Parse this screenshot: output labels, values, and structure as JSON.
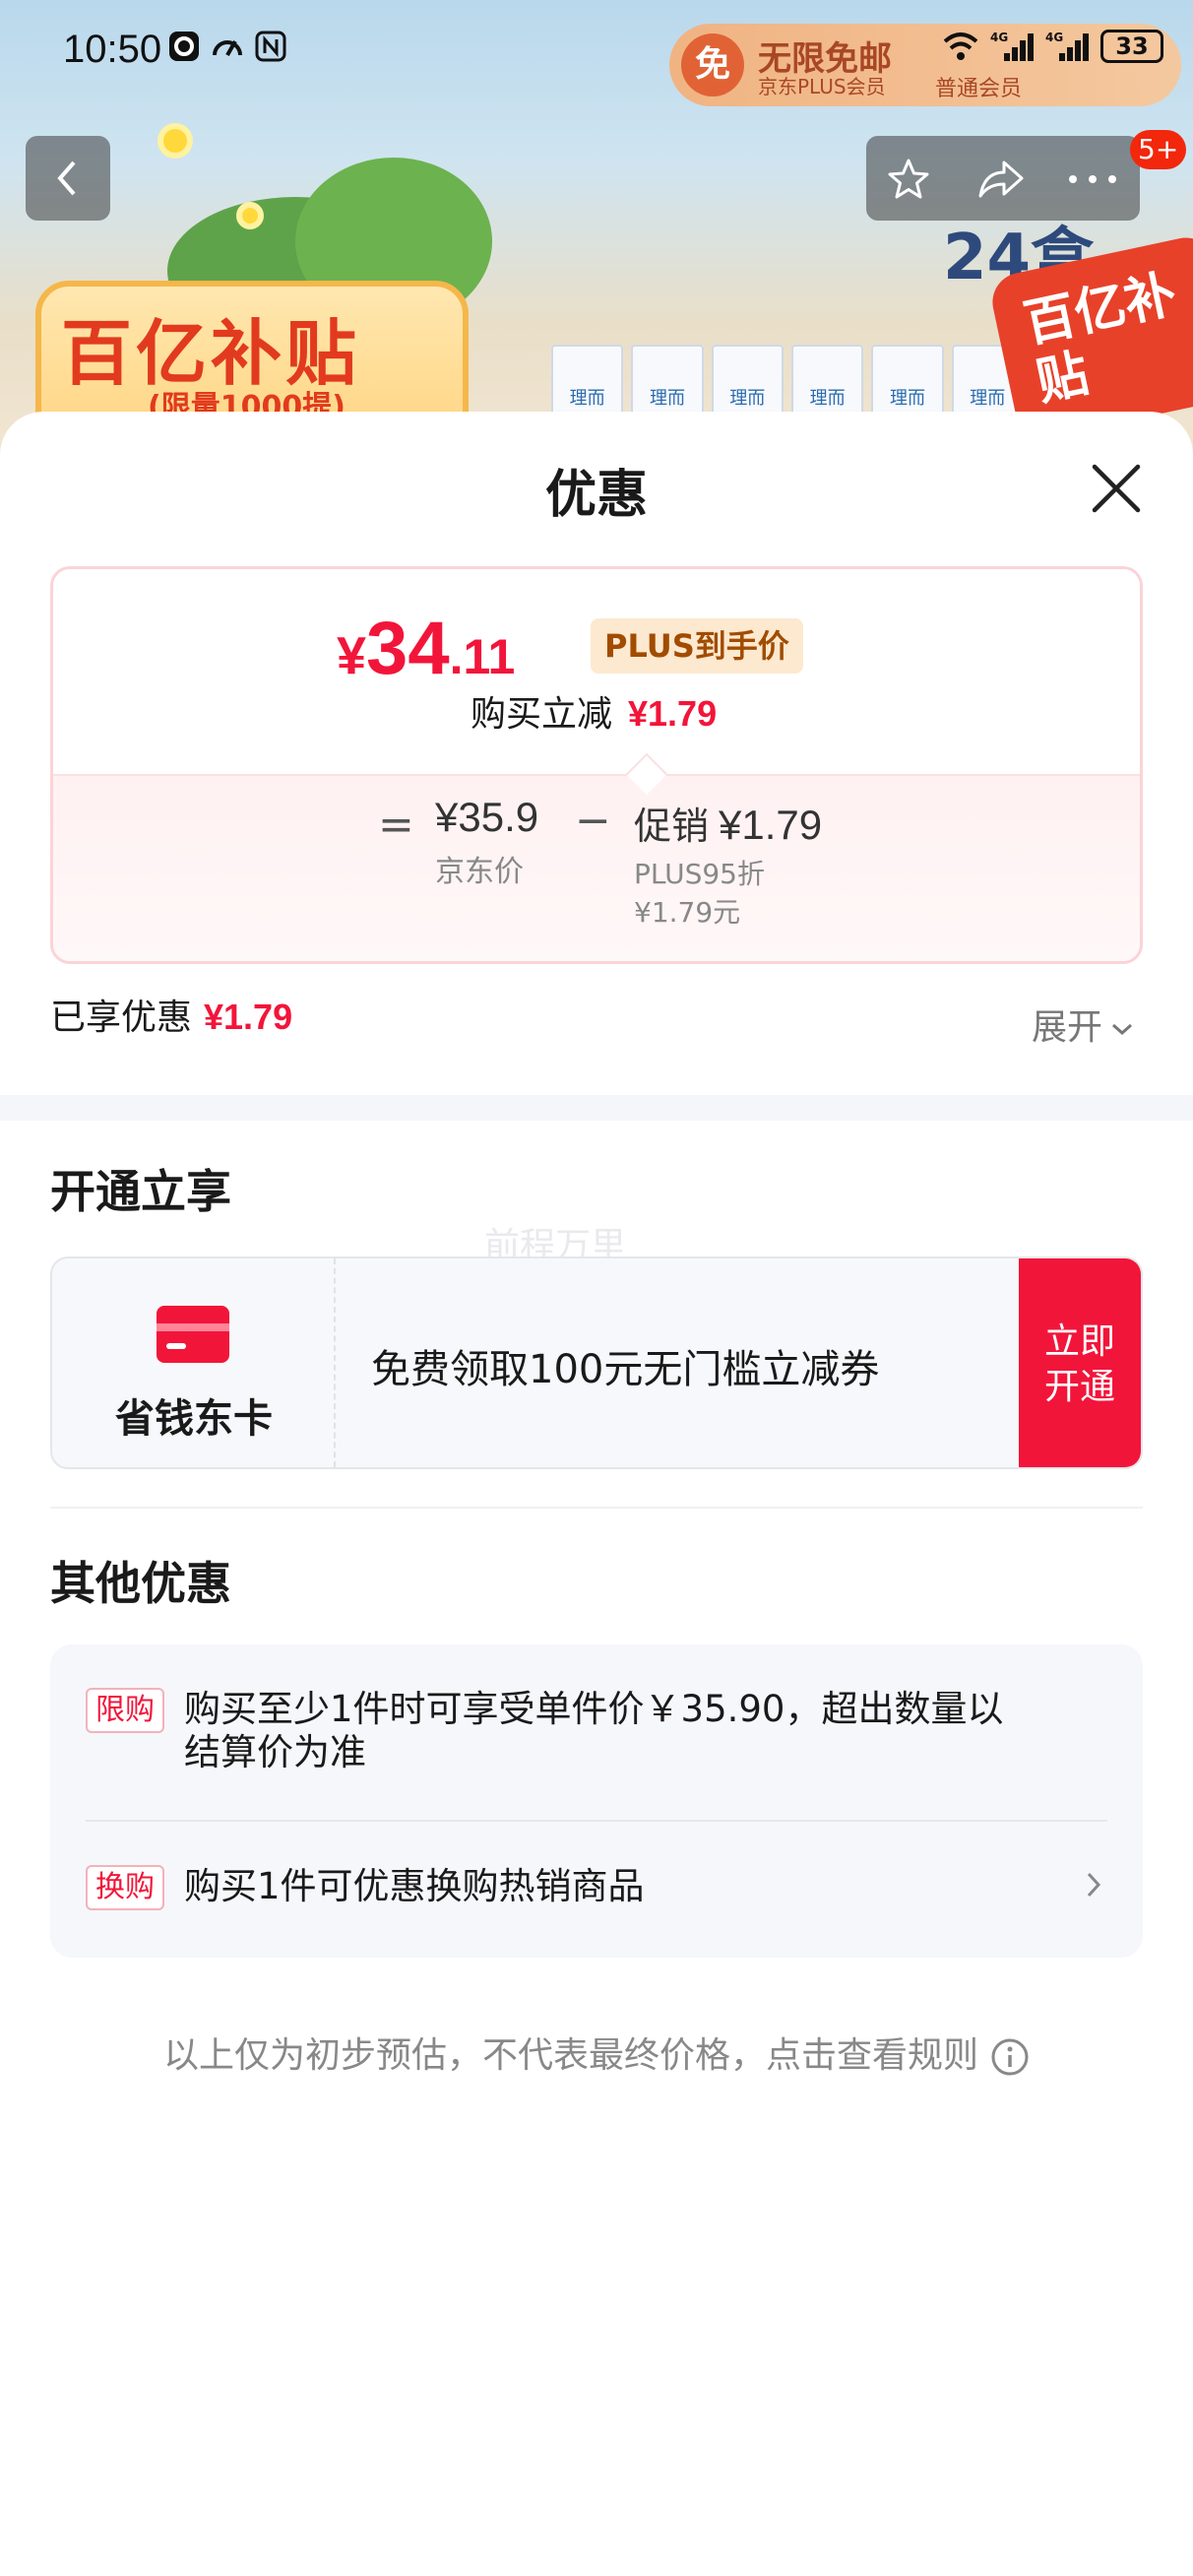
{
  "status_bar": {
    "time": "10:50",
    "battery": "33",
    "signal_labels": [
      "4G",
      "4G"
    ]
  },
  "background_page": {
    "plus_banner": {
      "icon_char": "免",
      "title": "无限免邮",
      "subtitle": "京东PLUS会员",
      "member": "普通会员"
    },
    "promo_title": "百亿补贴",
    "promo_subtitle": "(限量1000提)",
    "milk_brand": "理而",
    "count_label": "24盒",
    "corner_badge": "百亿补贴",
    "cart_badge": "5+"
  },
  "sheet": {
    "title": "优惠",
    "final_price": {
      "currency": "¥",
      "integer": "34",
      "decimal": ".11"
    },
    "plus_tag": "PLUS到手价",
    "reduce_label": "购买立减",
    "reduce_amount": "¥1.79",
    "breakdown": {
      "equals": "=",
      "jd_price": "¥35.9",
      "jd_label": "京东价",
      "minus": "−",
      "promo_label": "促销",
      "promo_amount": "¥1.79",
      "plus_discount": "PLUS95折",
      "plus_discount_amount": "¥1.79元"
    },
    "enjoyed_label": "已享优惠",
    "enjoyed_amount": "¥1.79",
    "expand_label": "展开"
  },
  "open_section": {
    "title": "开通立享",
    "watermark": "前程万里",
    "card_name": "省钱东卡",
    "card_desc": "免费领取100元无门槛立减券",
    "button_line1": "立即",
    "button_line2": "开通"
  },
  "other_section": {
    "title": "其他优惠",
    "items": [
      {
        "tag": "限购",
        "text_line1": "购买至少1件时可享受单件价￥35.90，超出数量以",
        "text_line2": "结算价为准"
      },
      {
        "tag": "换购",
        "text_line1": "购买1件可优惠换购热销商品"
      }
    ]
  },
  "footer": {
    "note": "以上仅为初步预估，不代表最终价格，点击查看规则"
  },
  "colors": {
    "accent_red": "#f2153a",
    "plus_gold": "#a14c00",
    "muted": "#888888"
  }
}
